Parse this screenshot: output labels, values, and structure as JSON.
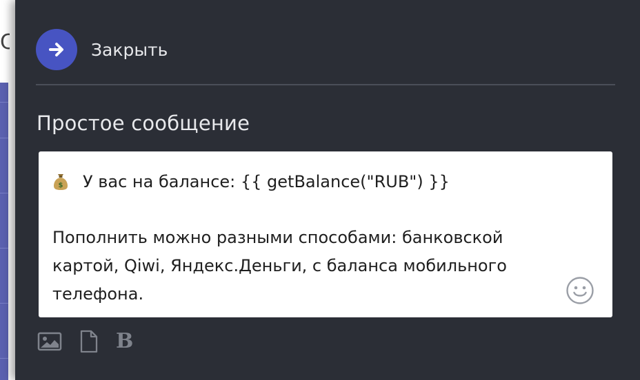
{
  "background": {
    "left_glyph": "С"
  },
  "panel": {
    "close_label": "Закрыть",
    "section_title": "Простое сообщение",
    "message": {
      "line1": "У вас на балансе: {{ getBalance(\"RUB\") }}",
      "line3": "Пополнить можно разными способами: банковской",
      "line4": "картой, Qiwi, Яндекс.Деньги, с баланса мобильного",
      "line5": "телефона.",
      "leading_icon": "money-bag-icon"
    },
    "toolbar": {
      "items": [
        "image-icon",
        "file-icon",
        "bold-icon"
      ],
      "bold_glyph": "B"
    }
  },
  "colors": {
    "panel_bg": "#2b2e36",
    "accent": "#4754c2",
    "text_light": "#e8e9ec",
    "toolbar_icon": "#7f838c"
  }
}
